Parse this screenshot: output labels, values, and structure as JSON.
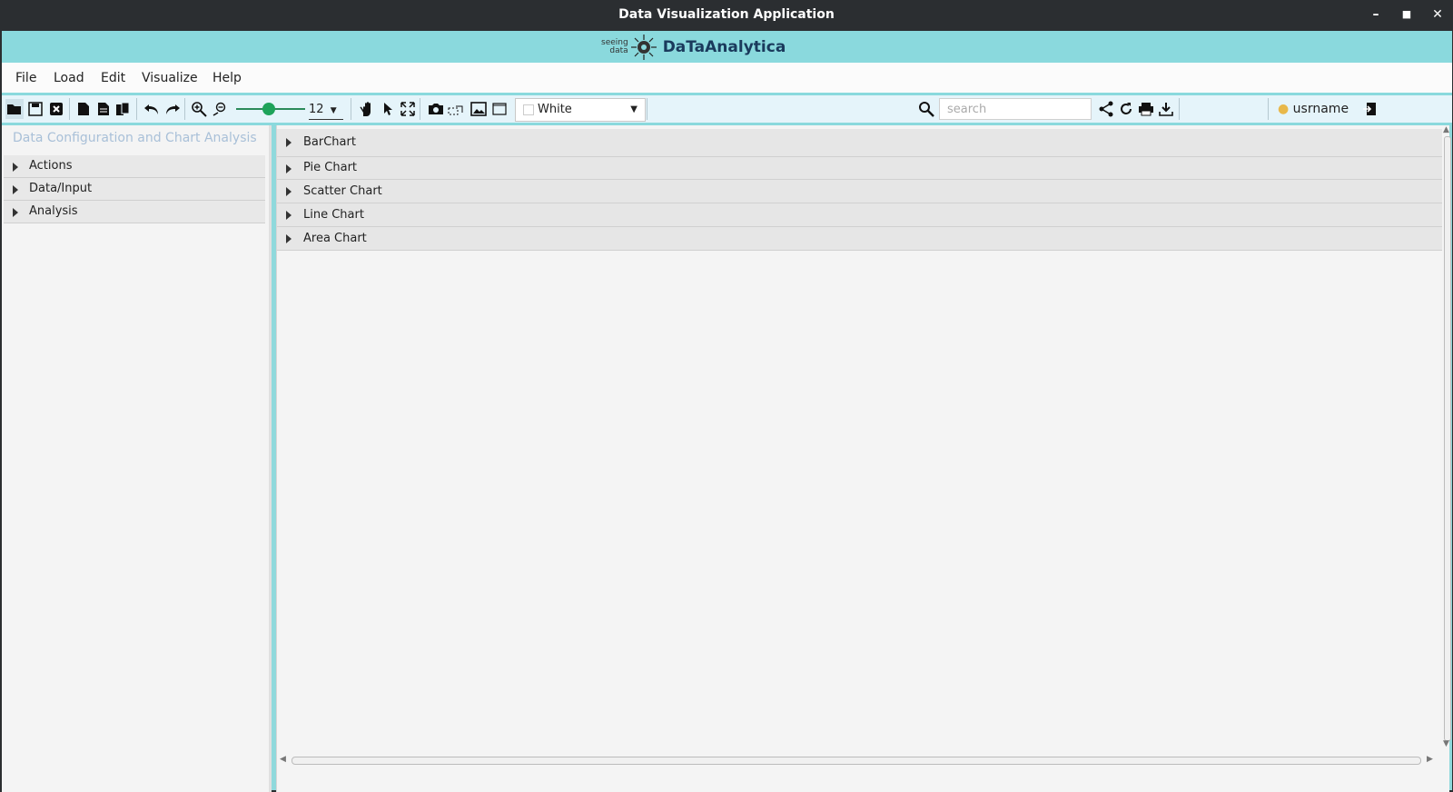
{
  "window": {
    "title": "Data Visualization Application",
    "controls": {
      "minimize": "–",
      "maximize": "■",
      "close": "✕"
    }
  },
  "banner": {
    "logo_sub_line1": "seeing",
    "logo_sub_line2": "data",
    "app_name": "DaTaAnalytica"
  },
  "menu": {
    "file": "File",
    "load": "Load",
    "edit": "Edit",
    "visualize": "Visualize",
    "help": "Help"
  },
  "toolbar": {
    "font_size": "12",
    "background_color": "White",
    "search_placeholder": "search",
    "username": "usrname"
  },
  "left_panel": {
    "title": "Data Configuration and Chart Analysis",
    "sections": [
      {
        "label": "Actions"
      },
      {
        "label": "Data/Input"
      },
      {
        "label": "Analysis"
      }
    ]
  },
  "chart_panels": [
    {
      "label": "BarChart"
    },
    {
      "label": "Pie Chart"
    },
    {
      "label": "Scatter Chart"
    },
    {
      "label": "Line Chart"
    },
    {
      "label": "Area Chart"
    }
  ],
  "colors": {
    "accent": "#8ad9dd",
    "toolbar_bg": "#e5f4fa",
    "slider": "#1ea35a"
  }
}
